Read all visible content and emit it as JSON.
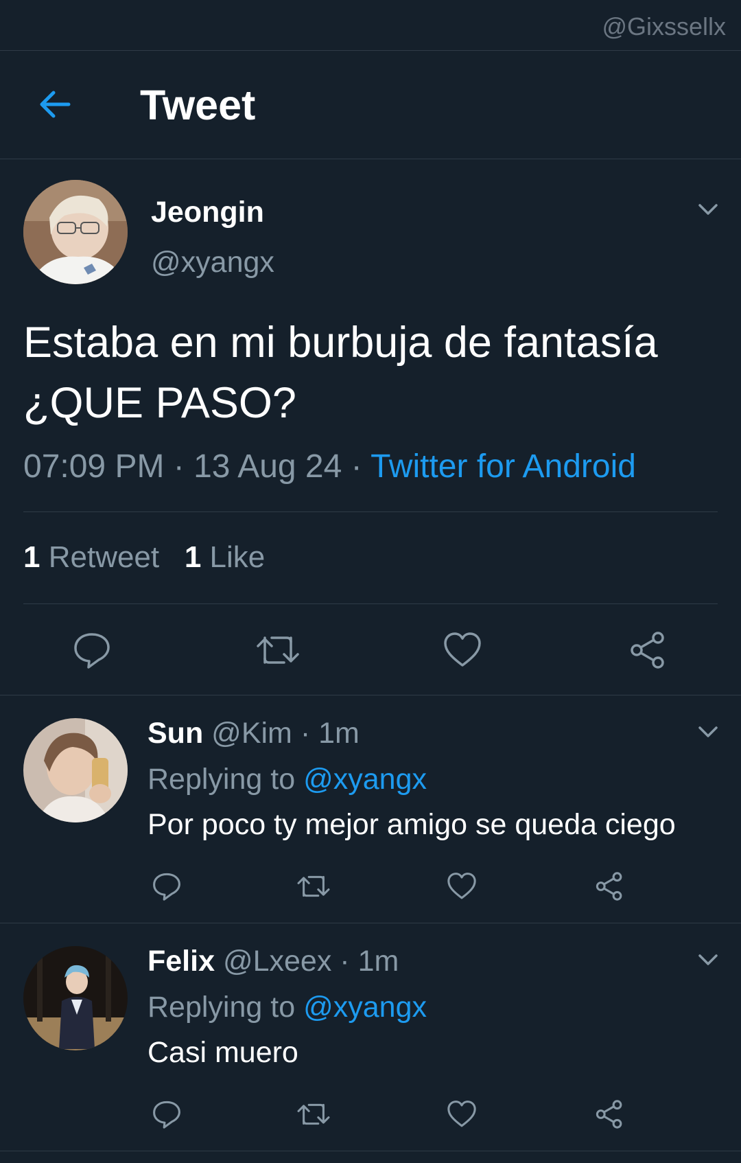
{
  "watermark": "@Gixssellx",
  "header": {
    "title": "Tweet",
    "back_icon": "arrow-left-icon"
  },
  "colors": {
    "background": "#15202b",
    "accent": "#1d9bf0",
    "muted": "#8899a6",
    "divider": "#2f3b47"
  },
  "tweet": {
    "author": {
      "name": "Jeongin",
      "handle": "@xyangx"
    },
    "text_lines": [
      "Estaba en mi burbuja de fantasía",
      "¿QUE PASO?"
    ],
    "time": "07:09 PM",
    "date": "13 Aug 24",
    "separator": " · ",
    "source": "Twitter for Android",
    "stats": {
      "retweets_count": "1",
      "retweets_label": "Retweet",
      "likes_count": "1",
      "likes_label": "Like"
    }
  },
  "replies": [
    {
      "name": "Sun",
      "handle": "@Kim",
      "time": "1m",
      "replying_label": "Replying to",
      "replying_to": "@xyangx",
      "text": "Por poco ty mejor amigo se queda ciego"
    },
    {
      "name": "Felix",
      "handle": "@Lxeex",
      "time": "1m",
      "replying_label": "Replying to",
      "replying_to": "@xyangx",
      "text": "Casi muero"
    }
  ]
}
